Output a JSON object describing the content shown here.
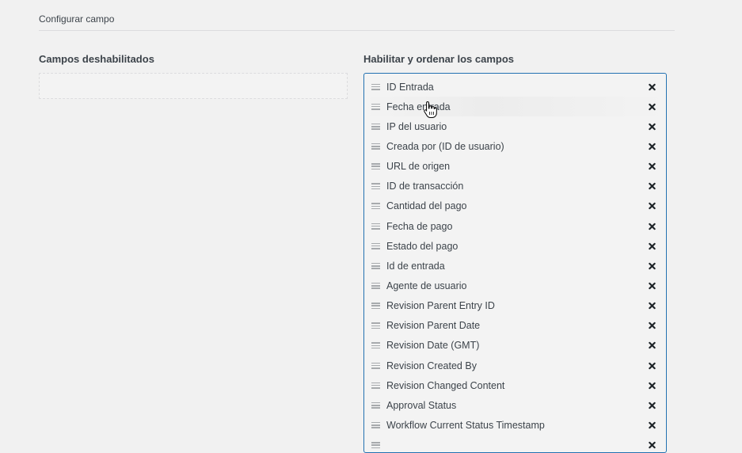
{
  "section": {
    "title": "Configurar campo"
  },
  "disabled_column": {
    "heading": "Campos deshabilitados",
    "fields": []
  },
  "enabled_column": {
    "heading": "Habilitar y ordenar los campos",
    "fields": [
      {
        "label": "ID Entrada"
      },
      {
        "label": "Fecha entrada"
      },
      {
        "label": "IP del usuario"
      },
      {
        "label": "Creada por (ID de usuario)"
      },
      {
        "label": "URL de origen"
      },
      {
        "label": "ID de transacción"
      },
      {
        "label": "Cantidad del pago"
      },
      {
        "label": "Fecha de pago"
      },
      {
        "label": "Estado del pago"
      },
      {
        "label": "Id de entrada"
      },
      {
        "label": "Agente de usuario"
      },
      {
        "label": "Revision Parent Entry ID"
      },
      {
        "label": "Revision Parent Date"
      },
      {
        "label": "Revision Date (GMT)"
      },
      {
        "label": "Revision Created By"
      },
      {
        "label": "Revision Changed Content"
      },
      {
        "label": "Approval Status"
      },
      {
        "label": "Workflow Current Status Timestamp"
      },
      {
        "label": ""
      }
    ]
  },
  "icons": {
    "drag_handle": "drag-handle-icon",
    "remove": "close-icon",
    "cursor": "hand-pointer-cursor"
  },
  "colors": {
    "background": "#f1f1f1",
    "enabled_border": "#2271b1",
    "text": "#3c434a",
    "handle": "#a7aaad",
    "remove_icon": "#1d2327"
  }
}
